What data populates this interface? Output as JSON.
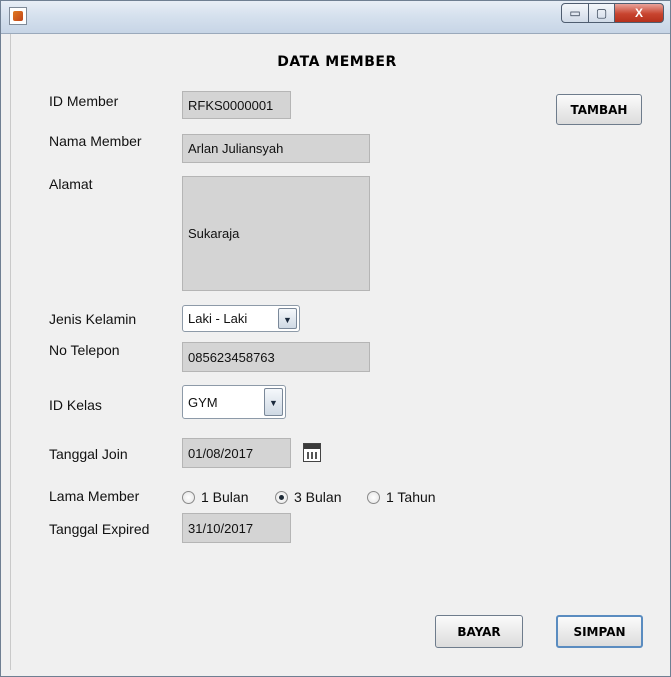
{
  "window": {
    "minimize_icon": "▭",
    "maximize_icon": "▢",
    "close_icon": "X"
  },
  "form": {
    "title": "DATA MEMBER",
    "id_member": {
      "label": "ID Member",
      "value": "RFKS0000001"
    },
    "nama_member": {
      "label": "Nama Member",
      "value": "Arlan Juliansyah"
    },
    "alamat": {
      "label": "Alamat",
      "value": "Sukaraja"
    },
    "jenis_kelamin": {
      "label": "Jenis Kelamin",
      "selected": "Laki - Laki"
    },
    "no_telepon": {
      "label": "No Telepon",
      "value": "085623458763"
    },
    "id_kelas": {
      "label": "ID Kelas",
      "selected": "GYM"
    },
    "tanggal_join": {
      "label": "Tanggal Join",
      "value": "01/08/2017"
    },
    "lama_member": {
      "label": "Lama Member",
      "options": [
        "1 Bulan",
        "3 Bulan",
        "1 Tahun"
      ],
      "selected": "3 Bulan"
    },
    "tanggal_expired": {
      "label": "Tanggal Expired",
      "value": "31/10/2017"
    }
  },
  "buttons": {
    "tambah": "TAMBAH",
    "bayar": "BAYAR",
    "simpan": "SIMPAN"
  },
  "combo_arrow": "▼"
}
